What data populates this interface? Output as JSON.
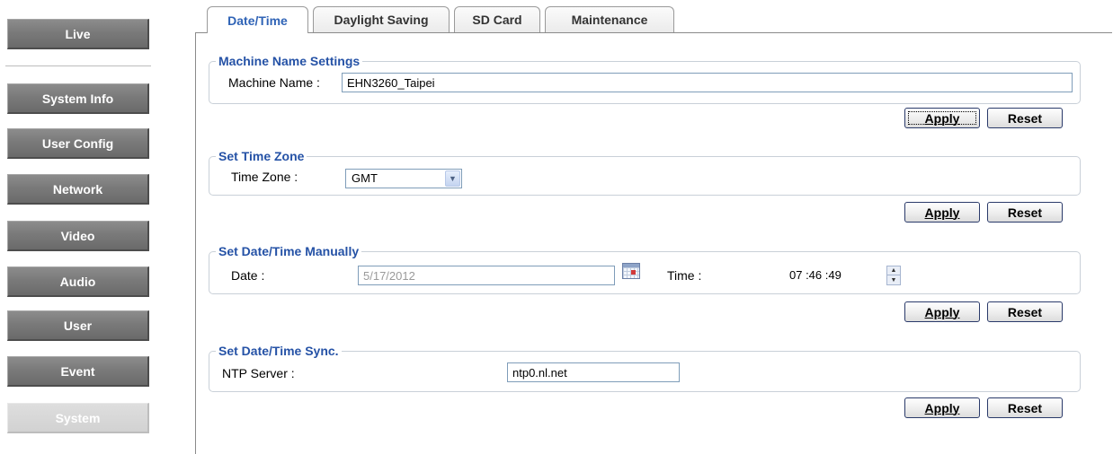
{
  "sidebar": {
    "live": "Live",
    "items": [
      {
        "label": "System Info"
      },
      {
        "label": "User Config"
      },
      {
        "label": "Network"
      },
      {
        "label": "Video"
      },
      {
        "label": "Audio"
      },
      {
        "label": "User"
      },
      {
        "label": "Event"
      },
      {
        "label": "System"
      }
    ],
    "active": "System"
  },
  "tabs": [
    {
      "label": "Date/Time",
      "active": true
    },
    {
      "label": "Daylight Saving",
      "active": false
    },
    {
      "label": "SD Card",
      "active": false
    },
    {
      "label": "Maintenance",
      "active": false
    }
  ],
  "machine_name": {
    "legend": "Machine Name Settings",
    "label": "Machine Name :",
    "value": "EHN3260_Taipei"
  },
  "time_zone": {
    "legend": "Set Time Zone",
    "label": "Time Zone :",
    "selected": "GMT"
  },
  "manual": {
    "legend": "Set Date/Time Manually",
    "date_label": "Date :",
    "date_value": "5/17/2012",
    "time_label": "Time :",
    "time_value": "07 :46 :49"
  },
  "sync": {
    "legend": "Set Date/Time Sync.",
    "ntp_label": "NTP Server :",
    "ntp_value": "ntp0.nl.net"
  },
  "buttons": {
    "apply": "Apply",
    "reset": "Reset"
  },
  "colors": {
    "legend_text": "#2552a6",
    "active_tab_text": "#2f63b6",
    "sidebar_button": "#7a7a7a",
    "sidebar_active": "#d2d2d2"
  }
}
